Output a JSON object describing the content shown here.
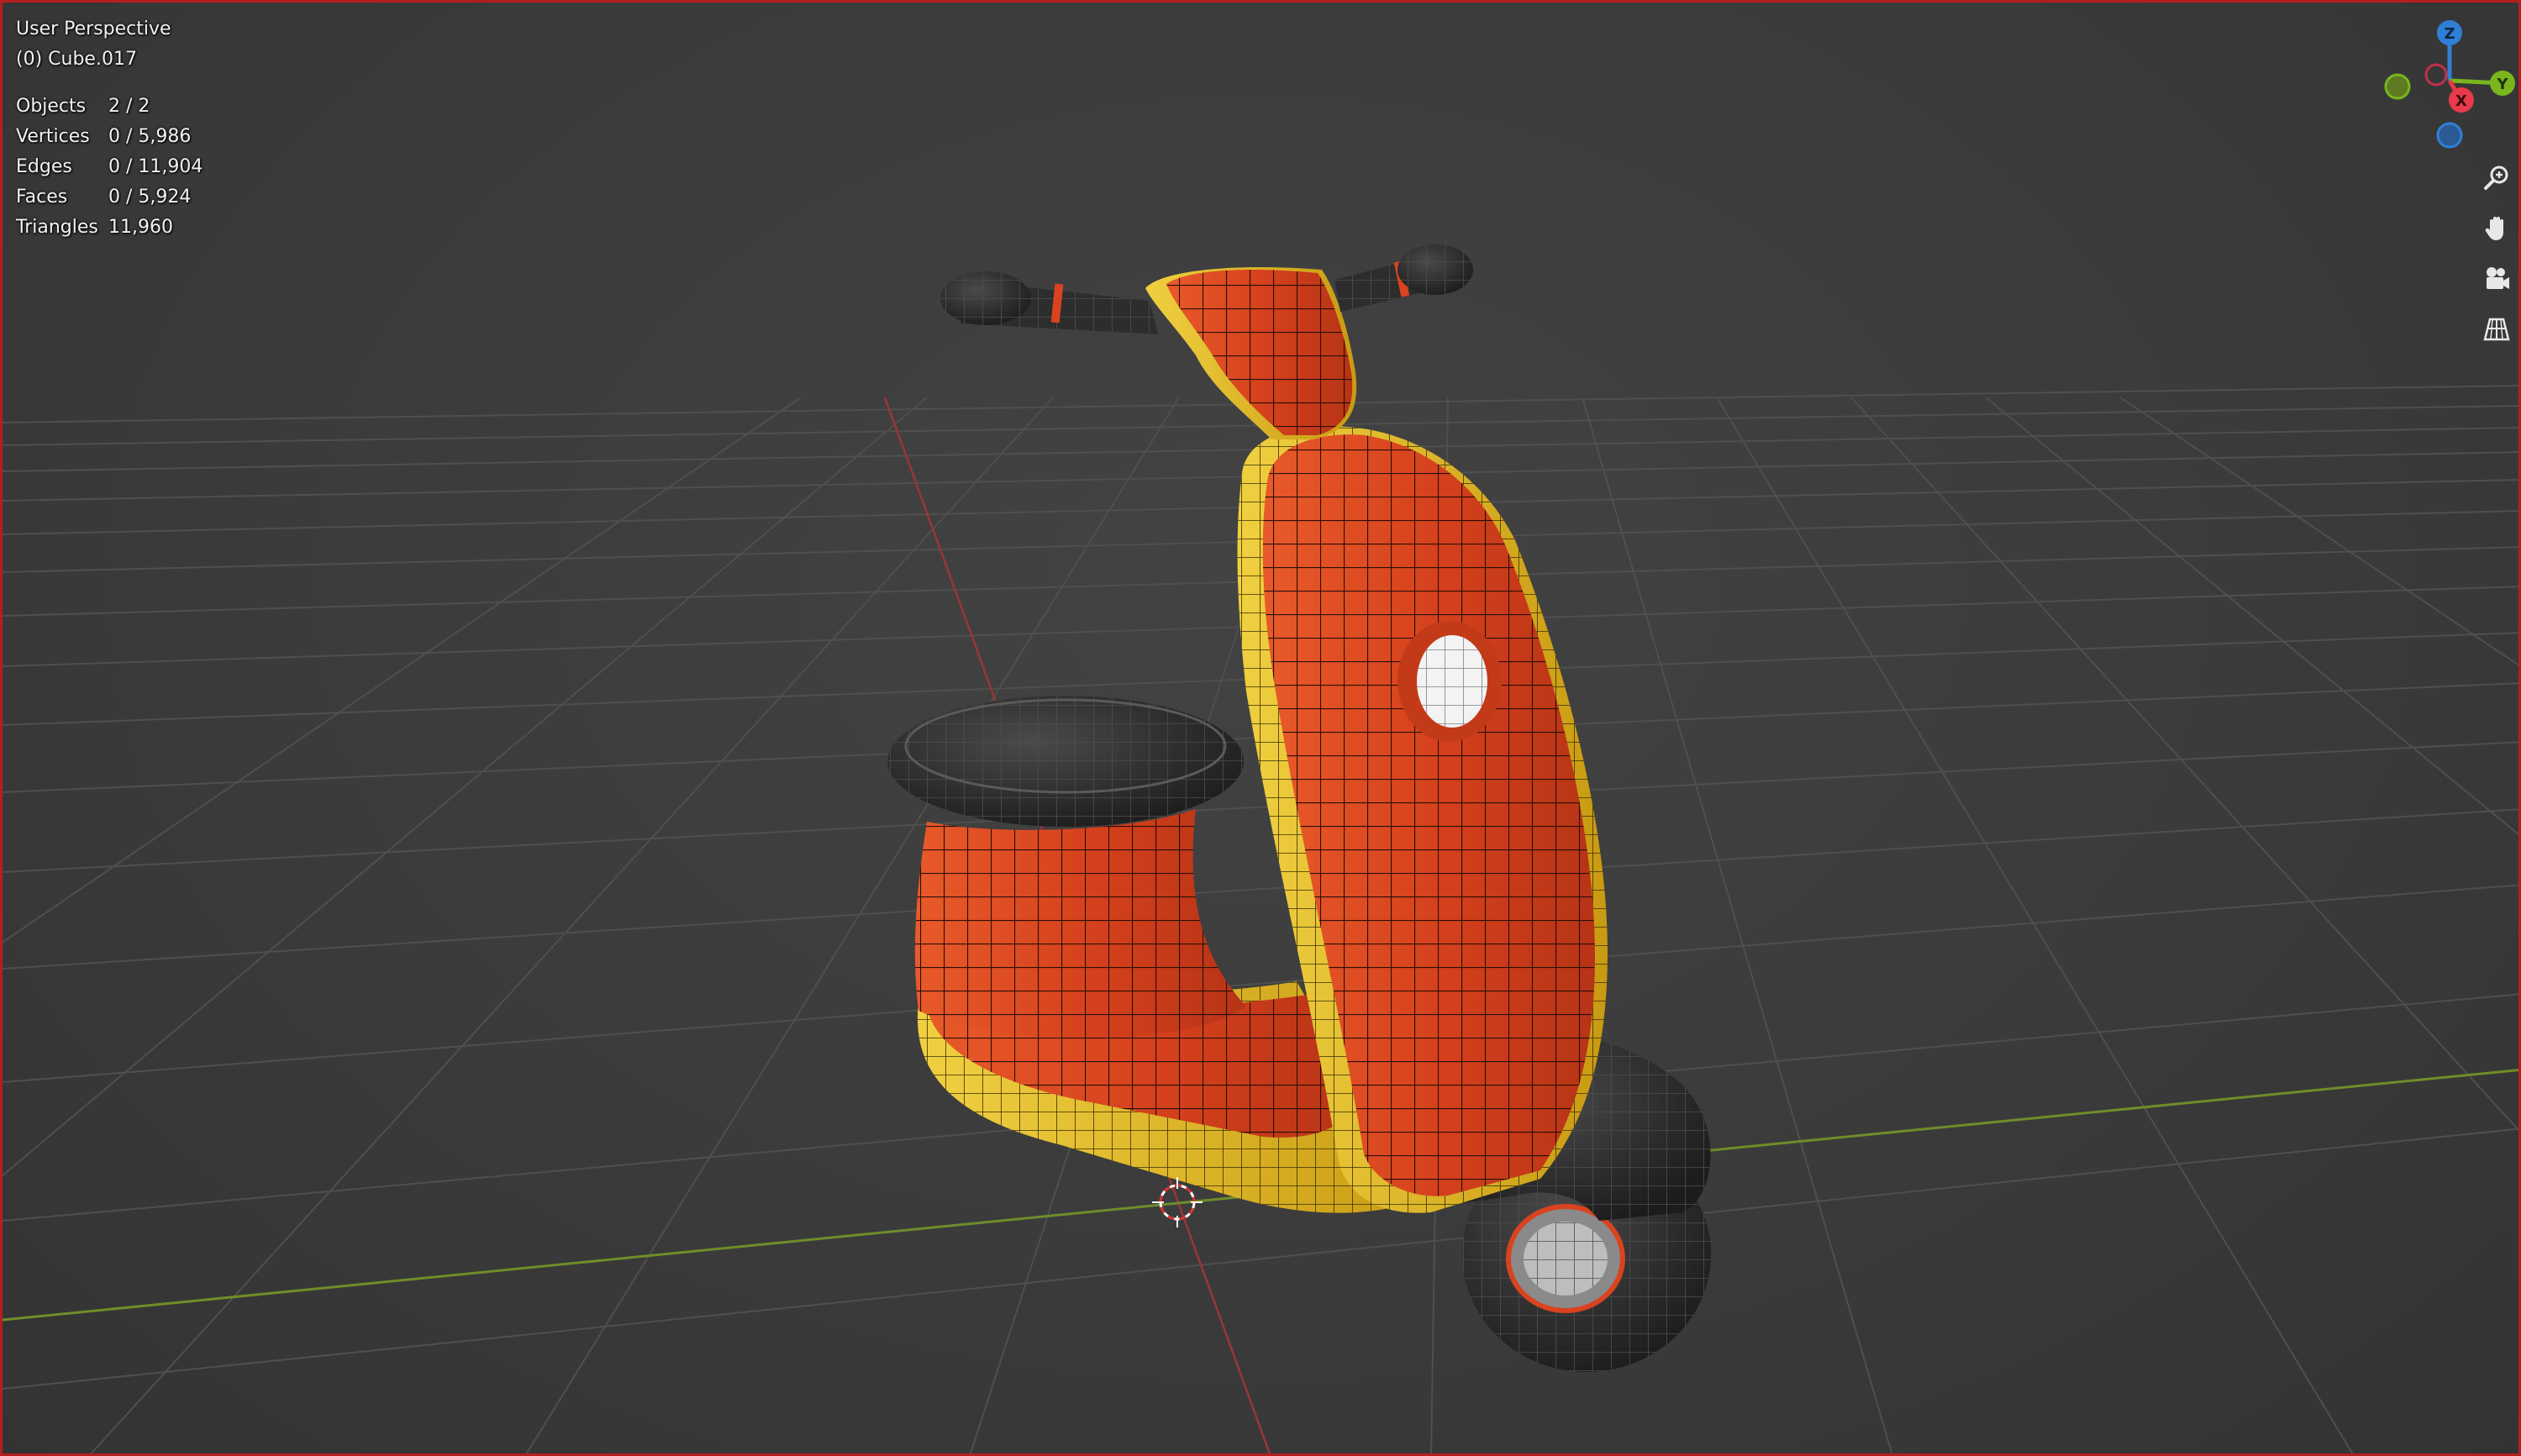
{
  "viewport": {
    "mode": "User Perspective",
    "active_object": "(0) Cube.017"
  },
  "stats": [
    {
      "label": "Objects",
      "value": "2 / 2"
    },
    {
      "label": "Vertices",
      "value": "0 / 5,986"
    },
    {
      "label": "Edges",
      "value": "0 / 11,904"
    },
    {
      "label": "Faces",
      "value": "0 / 5,924"
    },
    {
      "label": "Triangles",
      "value": "11,960"
    }
  ],
  "gizmo": {
    "z_label": "Z",
    "y_label": "Y",
    "x_label": "X"
  },
  "nav_tools": [
    {
      "name": "zoom-icon"
    },
    {
      "name": "pan-hand-icon"
    },
    {
      "name": "camera-icon"
    },
    {
      "name": "grid-perspective-icon"
    }
  ],
  "colors": {
    "background": "#3a3a3a",
    "border": "#b51e1e",
    "axis_x": "#b33a3a",
    "axis_y": "#7a9a2e",
    "body_red": "#d9431f",
    "trim_yellow": "#e1b820",
    "rubber_black": "#252525",
    "gizmo_z": "#2f7fd6",
    "gizmo_y": "#7ab51d",
    "gizmo_x": "#e83a4a"
  }
}
